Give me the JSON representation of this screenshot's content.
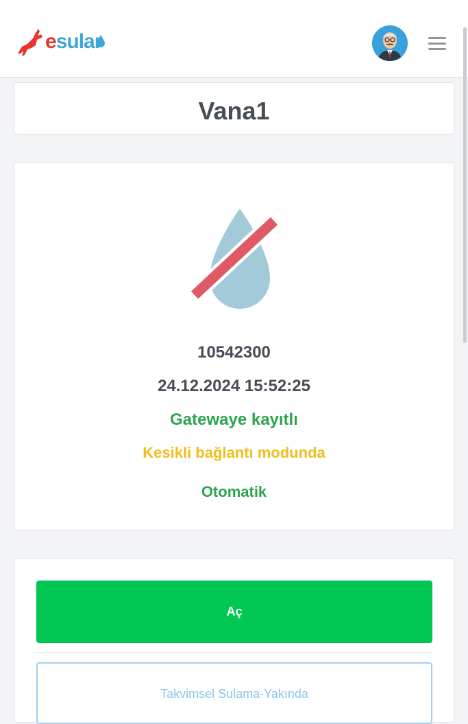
{
  "header": {
    "logo_e": "e",
    "logo_rest": "sular",
    "menu_icon": "hamburger-menu-icon",
    "avatar_icon": "user-avatar"
  },
  "device": {
    "name": "Vana1",
    "status_icon": "water-drop-off-icon",
    "serial": "10542300",
    "datetime": "24.12.2024 15:52:25",
    "gateway_status": "Gatewaye kayıtlı",
    "connection_mode": "Kesikli bağlantı modunda",
    "control_mode": "Otomatik"
  },
  "actions": {
    "open_label": "Aç",
    "schedule_label": "Takvimsel Sulama-Yakında"
  },
  "colors": {
    "brand_red": "#e8352b",
    "brand_blue": "#3fa7d6",
    "success": "#2ea44f",
    "warning": "#f0be1d",
    "open_button": "#00c853",
    "drop": "#a3cad8",
    "slash": "#e05a66"
  }
}
